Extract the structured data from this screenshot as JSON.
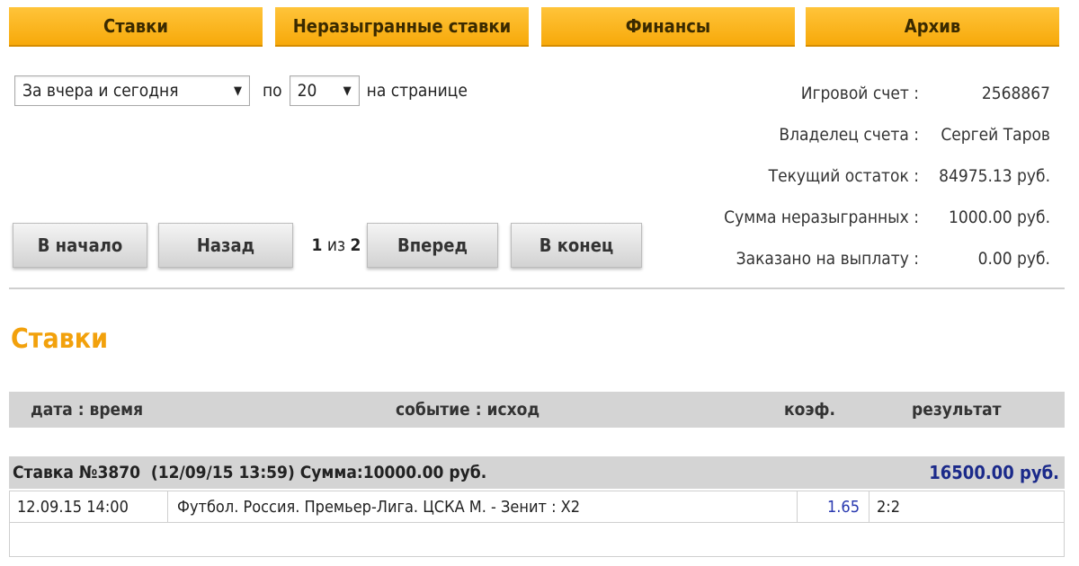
{
  "tabs": [
    {
      "label": "Ставки"
    },
    {
      "label": "Неразыгранные ставки"
    },
    {
      "label": "Финансы"
    },
    {
      "label": "Архив"
    }
  ],
  "filter": {
    "period_value": "За вчера и сегодня",
    "per_label": "по",
    "per_page_value": "20",
    "per_page_suffix": "на странице"
  },
  "account": {
    "rows": [
      {
        "key": "Игровой счет :",
        "value": "2568867"
      },
      {
        "key": "Владелец счета :",
        "value": "Сергей Таров"
      },
      {
        "key": "Текущий остаток :",
        "value": "84975.13 руб."
      },
      {
        "key": "Сумма неразыгранных :",
        "value": "1000.00 руб."
      },
      {
        "key": "Заказано на выплату :",
        "value": "0.00 руб."
      }
    ]
  },
  "pager": {
    "first": "В начало",
    "prev": "Назад",
    "current": "1",
    "of": "из",
    "total": "2",
    "next": "Вперед",
    "last": "В конец"
  },
  "section_title": "Ставки",
  "table": {
    "headers": [
      "дата : время",
      "событие : исход",
      "коэф.",
      "результат"
    ],
    "bet": {
      "summary": "Ставка №3870  (12/09/15 13:59) Сумма:10000.00 руб.",
      "result": "16500.00 руб.",
      "details": [
        {
          "datetime": "12.09.15 14:00",
          "event": "Футбол. Россия. Премьер-Лига. ЦСКА М. - Зенит : X2",
          "coef": "1.65",
          "result": "2:2"
        }
      ]
    }
  },
  "colors": {
    "tab_orange": "#f7a90a",
    "heading_orange": "#f2a10c",
    "result_blue": "#1b2a8a"
  }
}
